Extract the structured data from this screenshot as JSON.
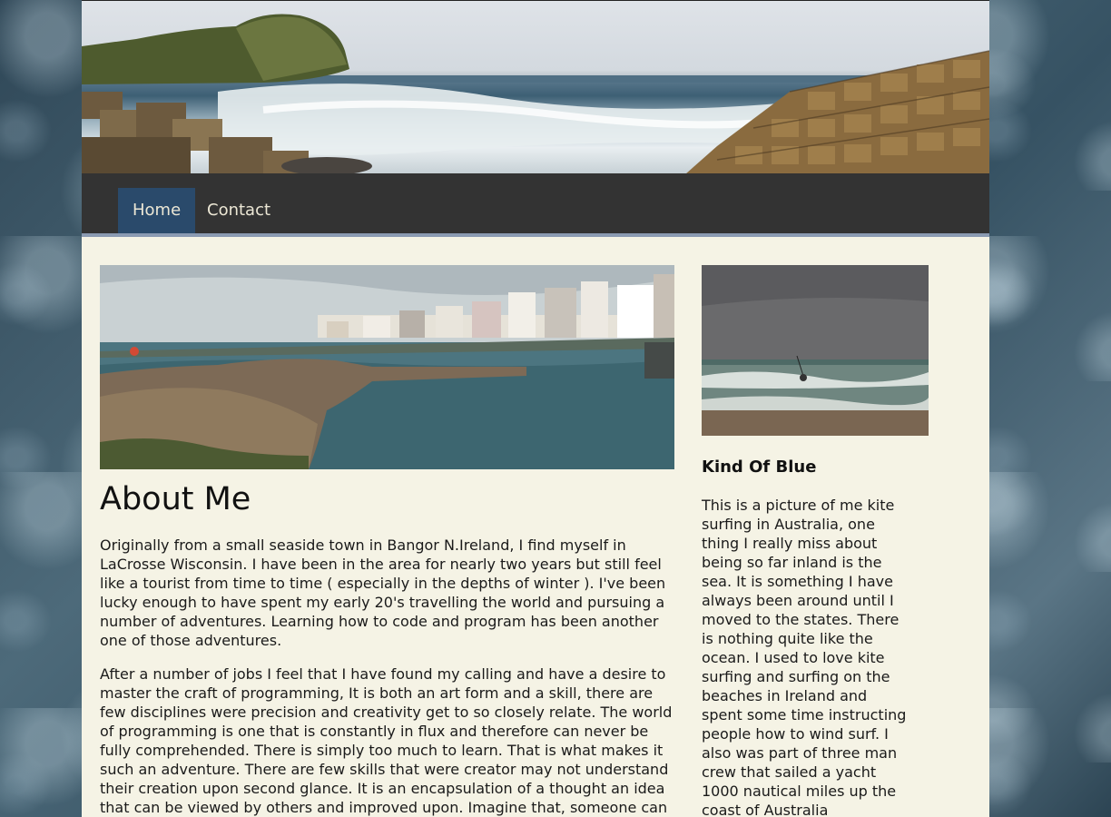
{
  "nav": {
    "items": [
      {
        "label": "Home",
        "active": true
      },
      {
        "label": "Contact",
        "active": false
      }
    ],
    "active_color": "#2a4a6b",
    "bar_color": "#333333"
  },
  "banner": {
    "description_icon": "coastline-photo"
  },
  "main": {
    "title": "About Me",
    "paragraphs": [
      "Originally from a small seaside town in Bangor N.Ireland, I find myself in LaCrosse Wisconsin. I have been in the area for nearly two years but still feel like a tourist from time to time ( especially in the depths of winter ). I've been lucky enough to have spent my early 20's travelling the world and pursuing a number of adventures. Learning how to code and program has been another one of those adventures.",
      "After a number of jobs I feel that I have found my calling and have a desire to master the craft of programming, It is both an art form and a skill, there are few disciplines were precision and creativity get to so closely relate. The world of programming is one that is constantly in flux and therefore can never be fully comprehended. There is simply too much to learn. That is what makes it such an adventure. There are few skills that were creator may not understand their creation upon second glance. It is an encapsulation of a thought an idea that can be viewed by others and improved upon. Imagine that, someone can take"
    ]
  },
  "sidebar": {
    "title": "Kind Of Blue",
    "text": "This is a picture of me kite surfing in Australia, one thing I really miss about being so far inland is the sea. It is something I have always been around until I moved to the states. There is nothing quite like the ocean. I used to love kite surfing and surfing on the beaches in Ireland and spent some time instructing people how to wind surf. I also was part of three man crew that sailed a yacht 1000 nautical miles up the coast of Australia"
  }
}
